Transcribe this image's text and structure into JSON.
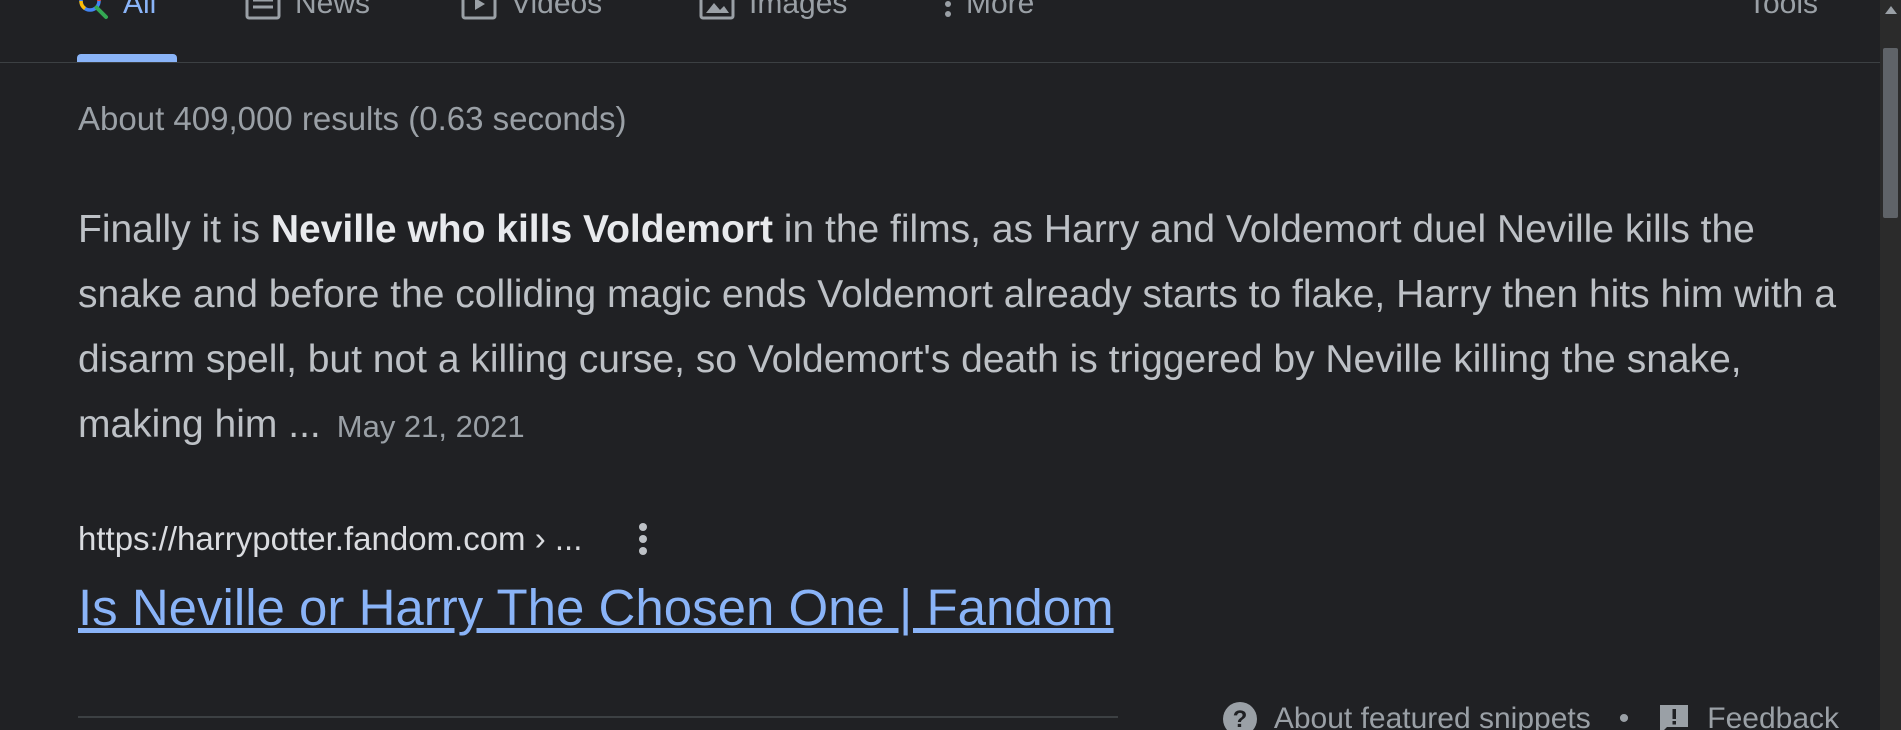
{
  "tabs": [
    {
      "label": "All",
      "icon": "search-icon",
      "active": true
    },
    {
      "label": "News",
      "icon": "news-icon"
    },
    {
      "label": "Videos",
      "icon": "video-icon"
    },
    {
      "label": "Images",
      "icon": "image-icon"
    },
    {
      "label": "More",
      "icon": "kebab-icon"
    }
  ],
  "tools_label": "Tools",
  "result_stats": "About 409,000 results (0.63 seconds)",
  "snippet": {
    "lead": "Finally it is ",
    "bold": "Neville who kills Voldemort",
    "rest": " in the films, as Harry and Voldemort duel Neville kills the snake and before the colliding magic ends Voldemort already starts to flake, Harry then hits him with a disarm spell, but not a killing curse, so Voldemort's death is triggered by Neville killing the snake, making him ...",
    "date": "May 21, 2021"
  },
  "source": {
    "url": "https://harrypotter.fandom.com › ...",
    "menu_icon": "more-vert-icon"
  },
  "result_title": "Is Neville or Harry The Chosen One | Fandom",
  "footer": {
    "about_label": "About featured snippets",
    "separator": "•",
    "feedback_label": "Feedback",
    "about_icon": "help-icon",
    "feedback_icon": "feedback-icon"
  },
  "colors": {
    "background": "#202124",
    "link": "#8ab4f8",
    "text": "#bdc1c6",
    "muted": "#9aa0a6"
  }
}
